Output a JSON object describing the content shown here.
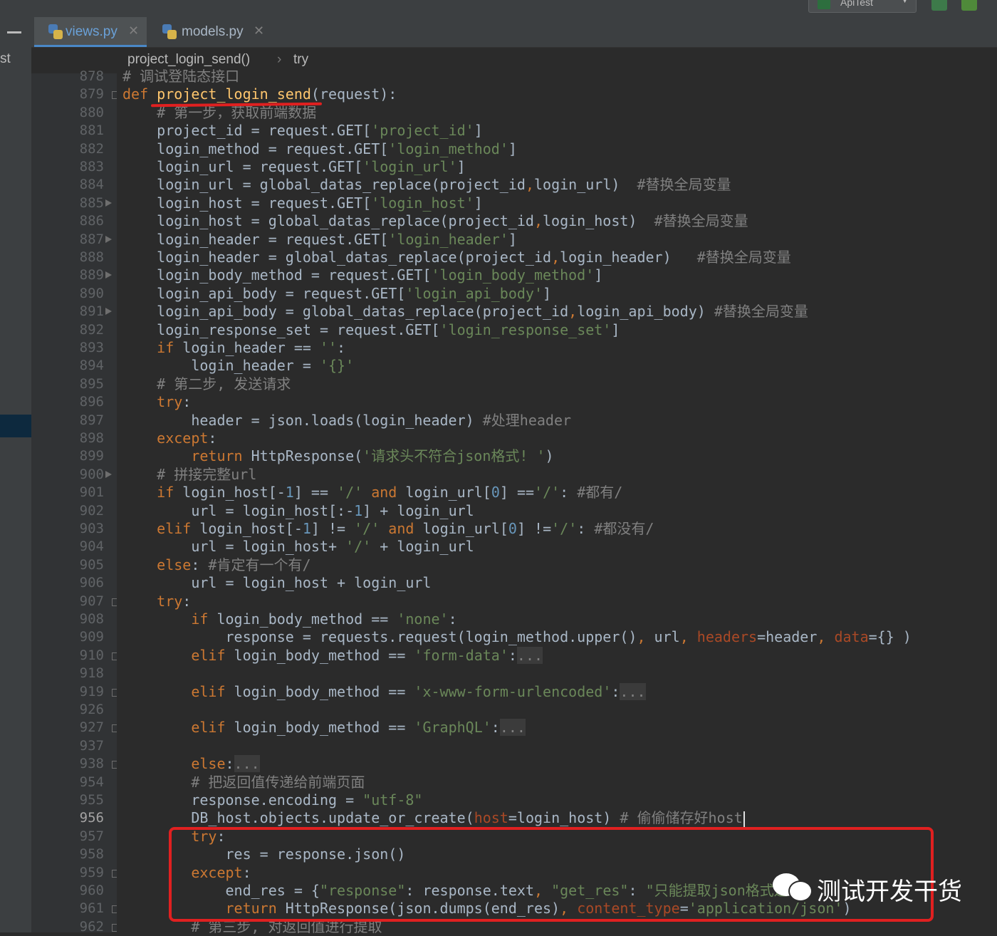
{
  "window": {
    "run_config": "ApiTest"
  },
  "sidebar": {
    "label": "st"
  },
  "tabs": [
    {
      "label": "views.py",
      "active": true
    },
    {
      "label": "models.py",
      "active": false
    }
  ],
  "breadcrumb": {
    "func": "project_login_send()",
    "sep": "›",
    "block": "try"
  },
  "colors": {
    "keyword": "#cc7832",
    "string": "#6a8759",
    "number": "#6897bb",
    "comment": "#808080",
    "function": "#ffc66d",
    "kwarg": "#aa4926",
    "text": "#a9b7c6",
    "annotation": "#e02020"
  },
  "editor": {
    "current_line": "956",
    "lines": [
      {
        "n": "878",
        "t": [
          {
            "c": "cmt",
            "v": "# 调试登陆态接口"
          }
        ]
      },
      {
        "n": "879",
        "t": [
          {
            "c": "kw",
            "v": "def "
          },
          {
            "c": "fn",
            "v": "project_login_send"
          },
          {
            "c": "",
            "v": "(request):"
          }
        ]
      },
      {
        "n": "880",
        "t": [
          {
            "c": "cmt",
            "v": "    # 第一步，获取前端数据"
          }
        ]
      },
      {
        "n": "881",
        "t": [
          {
            "c": "",
            "v": "    project_id = request.GET["
          },
          {
            "c": "str",
            "v": "'project_id'"
          },
          {
            "c": "",
            "v": "]"
          }
        ]
      },
      {
        "n": "882",
        "t": [
          {
            "c": "",
            "v": "    login_method = request.GET["
          },
          {
            "c": "str",
            "v": "'login_method'"
          },
          {
            "c": "",
            "v": "]"
          }
        ]
      },
      {
        "n": "883",
        "t": [
          {
            "c": "",
            "v": "    login_url = request.GET["
          },
          {
            "c": "str",
            "v": "'login_url'"
          },
          {
            "c": "",
            "v": "]"
          }
        ]
      },
      {
        "n": "884",
        "t": [
          {
            "c": "",
            "v": "    login_url = global_datas_replace(project_id"
          },
          {
            "c": "kw",
            "v": ","
          },
          {
            "c": "",
            "v": "login_url)  "
          },
          {
            "c": "cmt",
            "v": "#替换全局变量"
          }
        ]
      },
      {
        "n": "885",
        "t": [
          {
            "c": "",
            "v": "    login_host = request.GET["
          },
          {
            "c": "str",
            "v": "'login_host'"
          },
          {
            "c": "",
            "v": "]"
          }
        ]
      },
      {
        "n": "886",
        "t": [
          {
            "c": "",
            "v": "    login_host = global_datas_replace(project_id"
          },
          {
            "c": "kw",
            "v": ","
          },
          {
            "c": "",
            "v": "login_host)  "
          },
          {
            "c": "cmt",
            "v": "#替换全局变量"
          }
        ]
      },
      {
        "n": "887",
        "t": [
          {
            "c": "",
            "v": "    login_header = request.GET["
          },
          {
            "c": "str",
            "v": "'login_header'"
          },
          {
            "c": "",
            "v": "]"
          }
        ]
      },
      {
        "n": "888",
        "t": [
          {
            "c": "",
            "v": "    login_header = global_datas_replace(project_id"
          },
          {
            "c": "kw",
            "v": ","
          },
          {
            "c": "",
            "v": "login_header)   "
          },
          {
            "c": "cmt",
            "v": "#替换全局变量"
          }
        ]
      },
      {
        "n": "889",
        "t": [
          {
            "c": "",
            "v": "    login_body_method = request.GET["
          },
          {
            "c": "str",
            "v": "'login_body_method'"
          },
          {
            "c": "",
            "v": "]"
          }
        ]
      },
      {
        "n": "890",
        "t": [
          {
            "c": "",
            "v": "    login_api_body = request.GET["
          },
          {
            "c": "str",
            "v": "'login_api_body'"
          },
          {
            "c": "",
            "v": "]"
          }
        ]
      },
      {
        "n": "891",
        "t": [
          {
            "c": "",
            "v": "    login_api_body = global_datas_replace(project_id"
          },
          {
            "c": "kw",
            "v": ","
          },
          {
            "c": "",
            "v": "login_api_body) "
          },
          {
            "c": "cmt",
            "v": "#替换全局变量"
          }
        ]
      },
      {
        "n": "892",
        "t": [
          {
            "c": "",
            "v": "    login_response_set = request.GET["
          },
          {
            "c": "str",
            "v": "'login_response_set'"
          },
          {
            "c": "",
            "v": "]"
          }
        ]
      },
      {
        "n": "893",
        "t": [
          {
            "c": "kw",
            "v": "    if "
          },
          {
            "c": "",
            "v": "login_header == "
          },
          {
            "c": "str",
            "v": "''"
          },
          {
            "c": "",
            "v": ":"
          }
        ]
      },
      {
        "n": "894",
        "t": [
          {
            "c": "",
            "v": "        login_header = "
          },
          {
            "c": "str",
            "v": "'{}'"
          }
        ]
      },
      {
        "n": "895",
        "t": [
          {
            "c": "cmt",
            "v": "    # 第二步, 发送请求"
          }
        ]
      },
      {
        "n": "896",
        "t": [
          {
            "c": "kw",
            "v": "    try"
          },
          {
            "c": "",
            "v": ":"
          }
        ]
      },
      {
        "n": "897",
        "t": [
          {
            "c": "",
            "v": "        header = json.loads(login_header) "
          },
          {
            "c": "cmt",
            "v": "#处理header"
          }
        ]
      },
      {
        "n": "898",
        "t": [
          {
            "c": "kw",
            "v": "    except"
          },
          {
            "c": "",
            "v": ":"
          }
        ]
      },
      {
        "n": "899",
        "t": [
          {
            "c": "kw",
            "v": "        return "
          },
          {
            "c": "",
            "v": "HttpResponse("
          },
          {
            "c": "str",
            "v": "'请求头不符合json格式! '"
          },
          {
            "c": "",
            "v": ")"
          }
        ]
      },
      {
        "n": "900",
        "t": [
          {
            "c": "cmt",
            "v": "    # 拼接完整url"
          }
        ]
      },
      {
        "n": "901",
        "t": [
          {
            "c": "kw",
            "v": "    if "
          },
          {
            "c": "",
            "v": "login_host[-"
          },
          {
            "c": "num",
            "v": "1"
          },
          {
            "c": "",
            "v": "] == "
          },
          {
            "c": "str",
            "v": "'/'"
          },
          {
            "c": "kw",
            "v": " and "
          },
          {
            "c": "",
            "v": "login_url["
          },
          {
            "c": "num",
            "v": "0"
          },
          {
            "c": "",
            "v": "] =="
          },
          {
            "c": "str",
            "v": "'/'"
          },
          {
            "c": "",
            "v": ": "
          },
          {
            "c": "cmt",
            "v": "#都有/"
          }
        ]
      },
      {
        "n": "902",
        "t": [
          {
            "c": "",
            "v": "        url = login_host[:-"
          },
          {
            "c": "num",
            "v": "1"
          },
          {
            "c": "",
            "v": "] + login_url"
          }
        ]
      },
      {
        "n": "903",
        "t": [
          {
            "c": "kw",
            "v": "    elif "
          },
          {
            "c": "",
            "v": "login_host[-"
          },
          {
            "c": "num",
            "v": "1"
          },
          {
            "c": "",
            "v": "] != "
          },
          {
            "c": "str",
            "v": "'/'"
          },
          {
            "c": "kw",
            "v": " and "
          },
          {
            "c": "",
            "v": "login_url["
          },
          {
            "c": "num",
            "v": "0"
          },
          {
            "c": "",
            "v": "] !="
          },
          {
            "c": "str",
            "v": "'/'"
          },
          {
            "c": "",
            "v": ": "
          },
          {
            "c": "cmt",
            "v": "#都没有/"
          }
        ]
      },
      {
        "n": "904",
        "t": [
          {
            "c": "",
            "v": "        url = login_host+ "
          },
          {
            "c": "str",
            "v": "'/'"
          },
          {
            "c": "",
            "v": " + login_url"
          }
        ]
      },
      {
        "n": "905",
        "t": [
          {
            "c": "kw",
            "v": "    else"
          },
          {
            "c": "",
            "v": ": "
          },
          {
            "c": "cmt",
            "v": "#肯定有一个有/"
          }
        ]
      },
      {
        "n": "906",
        "t": [
          {
            "c": "",
            "v": "        url = login_host + login_url"
          }
        ]
      },
      {
        "n": "907",
        "t": [
          {
            "c": "kw",
            "v": "    try"
          },
          {
            "c": "",
            "v": ":"
          }
        ]
      },
      {
        "n": "908",
        "t": [
          {
            "c": "kw",
            "v": "        if "
          },
          {
            "c": "",
            "v": "login_body_method == "
          },
          {
            "c": "str",
            "v": "'none'"
          },
          {
            "c": "",
            "v": ":"
          }
        ]
      },
      {
        "n": "909",
        "t": [
          {
            "c": "",
            "v": "            response = requests.request(login_method.upper()"
          },
          {
            "c": "kw",
            "v": ","
          },
          {
            "c": "",
            "v": " url"
          },
          {
            "c": "kw",
            "v": ", "
          },
          {
            "c": "kwarg",
            "v": "headers"
          },
          {
            "c": "",
            "v": "=header"
          },
          {
            "c": "kw",
            "v": ", "
          },
          {
            "c": "kwarg",
            "v": "data"
          },
          {
            "c": "",
            "v": "={} )"
          }
        ]
      },
      {
        "n": "910",
        "t": [
          {
            "c": "kw",
            "v": "        elif "
          },
          {
            "c": "",
            "v": "login_body_method == "
          },
          {
            "c": "str",
            "v": "'form-data'"
          },
          {
            "c": "",
            "v": ":"
          },
          {
            "c": "fold",
            "v": "..."
          }
        ]
      },
      {
        "n": "918",
        "t": []
      },
      {
        "n": "919",
        "t": [
          {
            "c": "kw",
            "v": "        elif "
          },
          {
            "c": "",
            "v": "login_body_method == "
          },
          {
            "c": "str",
            "v": "'x-www-form-urlencoded'"
          },
          {
            "c": "",
            "v": ":"
          },
          {
            "c": "fold",
            "v": "..."
          }
        ]
      },
      {
        "n": "926",
        "t": []
      },
      {
        "n": "927",
        "t": [
          {
            "c": "kw",
            "v": "        elif "
          },
          {
            "c": "",
            "v": "login_body_method == "
          },
          {
            "c": "str",
            "v": "'GraphQL'"
          },
          {
            "c": "",
            "v": ":"
          },
          {
            "c": "fold",
            "v": "..."
          }
        ]
      },
      {
        "n": "937",
        "t": []
      },
      {
        "n": "938",
        "t": [
          {
            "c": "kw",
            "v": "        else"
          },
          {
            "c": "",
            "v": ":"
          },
          {
            "c": "fold",
            "v": "..."
          }
        ]
      },
      {
        "n": "954",
        "t": [
          {
            "c": "cmt",
            "v": "        # 把返回值传递给前端页面"
          }
        ]
      },
      {
        "n": "955",
        "t": [
          {
            "c": "",
            "v": "        response.encoding = "
          },
          {
            "c": "str",
            "v": "\"utf-8\""
          }
        ]
      },
      {
        "n": "956",
        "t": [
          {
            "c": "",
            "v": "        DB_host.objects.update_or_create("
          },
          {
            "c": "kwarg",
            "v": "host"
          },
          {
            "c": "",
            "v": "=login_host) "
          },
          {
            "c": "cmt",
            "v": "# 偷偷储存好host"
          }
        ]
      },
      {
        "n": "957",
        "t": [
          {
            "c": "kw",
            "v": "        try"
          },
          {
            "c": "",
            "v": ":"
          }
        ]
      },
      {
        "n": "958",
        "t": [
          {
            "c": "",
            "v": "            res = response.json()"
          }
        ]
      },
      {
        "n": "959",
        "t": [
          {
            "c": "kw",
            "v": "        except"
          },
          {
            "c": "",
            "v": ":"
          }
        ]
      },
      {
        "n": "960",
        "t": [
          {
            "c": "",
            "v": "            end_res = {"
          },
          {
            "c": "str",
            "v": "\"response\""
          },
          {
            "c": "",
            "v": ": response.text"
          },
          {
            "c": "kw",
            "v": ", "
          },
          {
            "c": "str",
            "v": "\"get_res\""
          },
          {
            "c": "",
            "v": ": "
          },
          {
            "c": "str",
            "v": "\"只能提取json格式返"
          }
        ]
      },
      {
        "n": "961",
        "t": [
          {
            "c": "kw",
            "v": "            return "
          },
          {
            "c": "",
            "v": "HttpResponse(json.dumps(end_res)"
          },
          {
            "c": "kw",
            "v": ", "
          },
          {
            "c": "kwarg",
            "v": "content_type"
          },
          {
            "c": "",
            "v": "="
          },
          {
            "c": "str",
            "v": "'application/json'"
          },
          {
            "c": "",
            "v": ")"
          }
        ]
      },
      {
        "n": "962",
        "t": [
          {
            "c": "cmt",
            "v": "        # 第三步, 对返回值进行提取"
          }
        ]
      }
    ]
  },
  "watermark": {
    "text": "测试开发干货"
  }
}
